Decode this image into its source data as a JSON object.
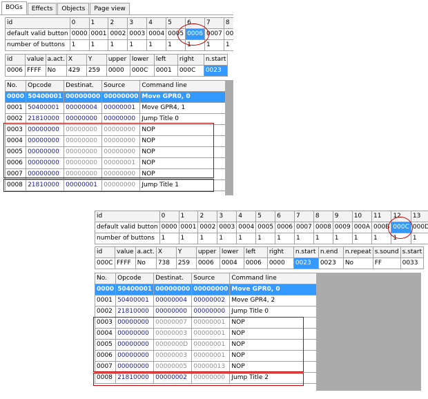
{
  "tabs": [
    "BOGs",
    "Effects",
    "Objects",
    "Page view"
  ],
  "panel1": {
    "grid": {
      "id_label": "id",
      "cols": [
        "0",
        "1",
        "2",
        "3",
        "4",
        "5",
        "6",
        "7",
        "8"
      ],
      "row1_label": "default valid button",
      "row1": [
        "0000",
        "0001",
        "0002",
        "0003",
        "0004",
        "0005",
        "0006",
        "0007",
        "000"
      ],
      "row2_label": "number of buttons",
      "row2": [
        "1",
        "1",
        "1",
        "1",
        "1",
        "1",
        "1",
        "1",
        "1"
      ]
    },
    "props": {
      "headers": [
        "id",
        "value",
        "a.act.",
        "X",
        "Y",
        "upper",
        "lower",
        "left",
        "right",
        "n.start"
      ],
      "values": [
        "0006",
        "FFFF",
        "No",
        "429",
        "259",
        "0000",
        "000C",
        "0001",
        "000C",
        "0023"
      ]
    },
    "cmd_headers": [
      "No.",
      "Opcode",
      "Destinat.",
      "Source",
      "Command line"
    ],
    "commands": [
      {
        "no": "0000",
        "op": "50400001",
        "dst": "00000000",
        "src": "00000000",
        "cmd": "Move GPR0, 0"
      },
      {
        "no": "0001",
        "op": "50400001",
        "dst": "00000004",
        "src": "00000001",
        "cmd": "Move GPR4, 1"
      },
      {
        "no": "0002",
        "op": "21810000",
        "dst": "00000000",
        "src": "00000000",
        "cmd": "Jump Title 0"
      },
      {
        "no": "0003",
        "op": "00000000",
        "dst": "00000000",
        "src": "00000000",
        "cmd": "NOP"
      },
      {
        "no": "0004",
        "op": "00000000",
        "dst": "00000000",
        "src": "00000000",
        "cmd": "NOP"
      },
      {
        "no": "0005",
        "op": "00000000",
        "dst": "00000000",
        "src": "00000000",
        "cmd": "NOP"
      },
      {
        "no": "0006",
        "op": "00000000",
        "dst": "00000000",
        "src": "00000001",
        "cmd": "NOP"
      },
      {
        "no": "0007",
        "op": "00000000",
        "dst": "00000000",
        "src": "00000000",
        "cmd": "NOP"
      },
      {
        "no": "0008",
        "op": "21810000",
        "dst": "00000001",
        "src": "00000000",
        "cmd": "Jump Title 1"
      }
    ]
  },
  "panel2": {
    "grid": {
      "id_label": "id",
      "cols": [
        "0",
        "1",
        "2",
        "3",
        "4",
        "5",
        "6",
        "7",
        "8",
        "9",
        "10",
        "11",
        "12",
        "13"
      ],
      "row1_label": "default valid button",
      "row1": [
        "0000",
        "0001",
        "0002",
        "0003",
        "0004",
        "0005",
        "0006",
        "0007",
        "0008",
        "0009",
        "000A",
        "000B",
        "000C",
        "000D"
      ],
      "row2_label": "number of buttons",
      "row2": [
        "1",
        "1",
        "1",
        "1",
        "1",
        "1",
        "1",
        "1",
        "1",
        "1",
        "1",
        "1",
        "1",
        "1"
      ]
    },
    "props": {
      "headers": [
        "id",
        "value",
        "a.act.",
        "X",
        "Y",
        "upper",
        "lower",
        "left",
        "right",
        "n.start",
        "n.end",
        "n.repeat",
        "s.sound",
        "s.start"
      ],
      "values": [
        "000C",
        "FFFF",
        "No",
        "738",
        "259",
        "0006",
        "0004",
        "0006",
        "0000",
        "0023",
        "0023",
        "No",
        "FF",
        "0033"
      ]
    },
    "cmd_headers": [
      "No.",
      "Opcode",
      "Destinat.",
      "Source",
      "Command line"
    ],
    "commands": [
      {
        "no": "0000",
        "op": "50400001",
        "dst": "00000000",
        "src": "00000000",
        "cmd": "Move GPR0, 0"
      },
      {
        "no": "0001",
        "op": "50400001",
        "dst": "00000004",
        "src": "00000002",
        "cmd": "Move GPR4, 2"
      },
      {
        "no": "0002",
        "op": "21810000",
        "dst": "00000000",
        "src": "00000000",
        "cmd": "Jump Title 0"
      },
      {
        "no": "0003",
        "op": "00000000",
        "dst": "00000007",
        "src": "00000001",
        "cmd": "NOP"
      },
      {
        "no": "0004",
        "op": "00000000",
        "dst": "00000003",
        "src": "00000001",
        "cmd": "NOP"
      },
      {
        "no": "0005",
        "op": "00000000",
        "dst": "0000000D",
        "src": "00000001",
        "cmd": "NOP"
      },
      {
        "no": "0006",
        "op": "00000000",
        "dst": "00000003",
        "src": "00000001",
        "cmd": "NOP"
      },
      {
        "no": "0007",
        "op": "00000000",
        "dst": "00000005",
        "src": "00000013",
        "cmd": "NOP"
      },
      {
        "no": "0008",
        "op": "21810000",
        "dst": "00000002",
        "src": "00000000",
        "cmd": "Jump Title 2"
      }
    ]
  }
}
